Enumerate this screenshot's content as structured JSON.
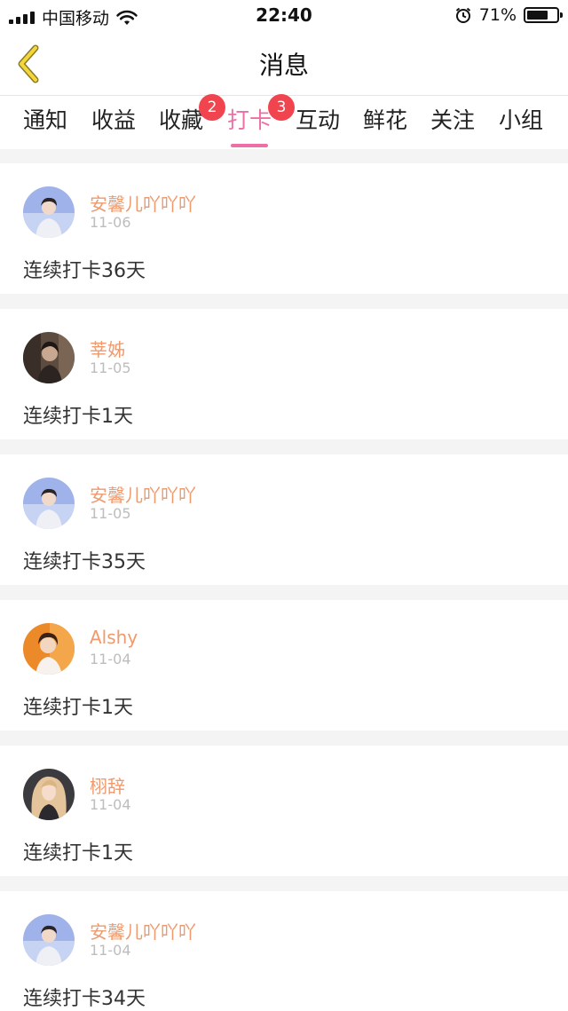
{
  "status_bar": {
    "carrier": "中国移动",
    "time": "22:40",
    "battery_pct": "71%",
    "battery_level": 0.71
  },
  "header": {
    "title": "消息",
    "back_icon": "chevron-left-icon",
    "accent": "#f2d63a"
  },
  "tabs": [
    {
      "label": "通知",
      "badge": "",
      "active": false
    },
    {
      "label": "收益",
      "badge": "",
      "active": false
    },
    {
      "label": "收藏",
      "badge": "2",
      "active": false
    },
    {
      "label": "打卡",
      "badge": "3",
      "active": true
    },
    {
      "label": "互动",
      "badge": "",
      "active": false
    },
    {
      "label": "鲜花",
      "badge": "",
      "active": false
    },
    {
      "label": "关注",
      "badge": "",
      "active": false
    },
    {
      "label": "小组",
      "badge": "",
      "active": false
    }
  ],
  "colors": {
    "active_tab": "#ee6fa6",
    "badge": "#f0444e",
    "username": "#ef9a6c",
    "date": "#bdbdbd"
  },
  "feed": [
    {
      "name": "安馨儿吖吖吖",
      "date": "11-06",
      "text": "连续打卡36天",
      "avatar": "boy-avatar"
    },
    {
      "name": "莘姊",
      "date": "11-05",
      "text": "连续打卡1天",
      "avatar": "dark-photo-avatar"
    },
    {
      "name": "安馨儿吖吖吖",
      "date": "11-05",
      "text": "连续打卡35天",
      "avatar": "boy-avatar"
    },
    {
      "name": "Alshy",
      "date": "11-04",
      "text": "连续打卡1天",
      "avatar": "orange-avatar"
    },
    {
      "name": "栩辞",
      "date": "11-04",
      "text": "连续打卡1天",
      "avatar": "blonde-avatar"
    },
    {
      "name": "安馨儿吖吖吖",
      "date": "11-04",
      "text": "连续打卡34天",
      "avatar": "boy-avatar"
    }
  ]
}
